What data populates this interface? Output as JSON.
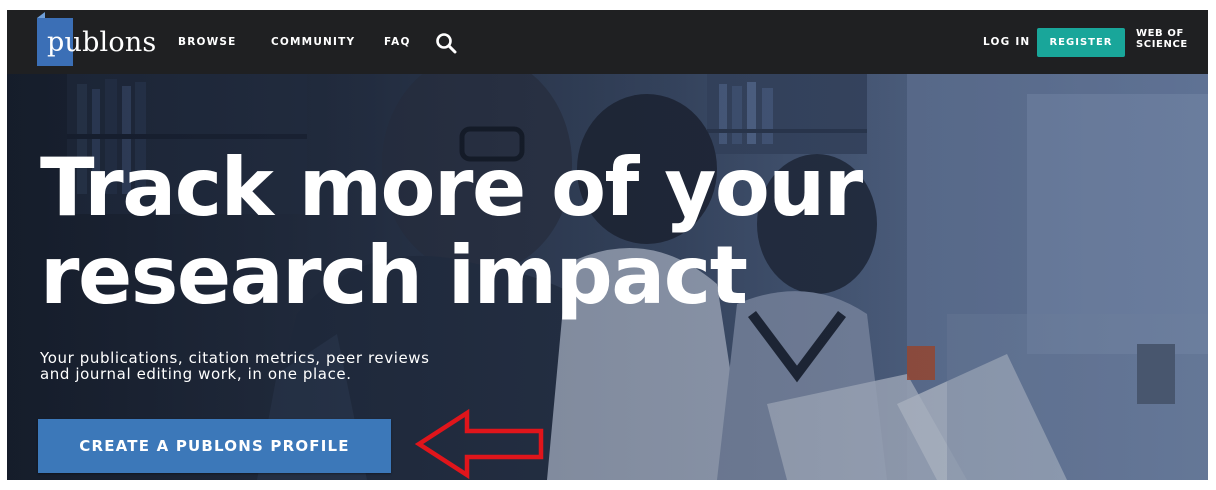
{
  "brand": {
    "logo_text": "publons"
  },
  "nav": {
    "browse": "BROWSE",
    "community": "COMMUNITY",
    "faq": "FAQ",
    "search_icon": "search-icon",
    "login": "LOG IN",
    "register": "REGISTER",
    "web_of_science": [
      "WEB OF",
      "SCIENCE"
    ]
  },
  "hero": {
    "headline": [
      "Track more of your",
      "research impact"
    ],
    "subtitle": [
      "Your publications, citation metrics, peer reviews",
      "and journal editing work, in one place."
    ],
    "cta_label": "CREATE A PUBLONS PROFILE",
    "annotation_icon": "red-arrow-left-icon"
  },
  "colors": {
    "navbar": "#1f2022",
    "register_button": "#19a69a",
    "cta_button": "#3c78b9",
    "logo_mark": "#3b6fb6",
    "annotation_arrow": "#e0151b"
  }
}
